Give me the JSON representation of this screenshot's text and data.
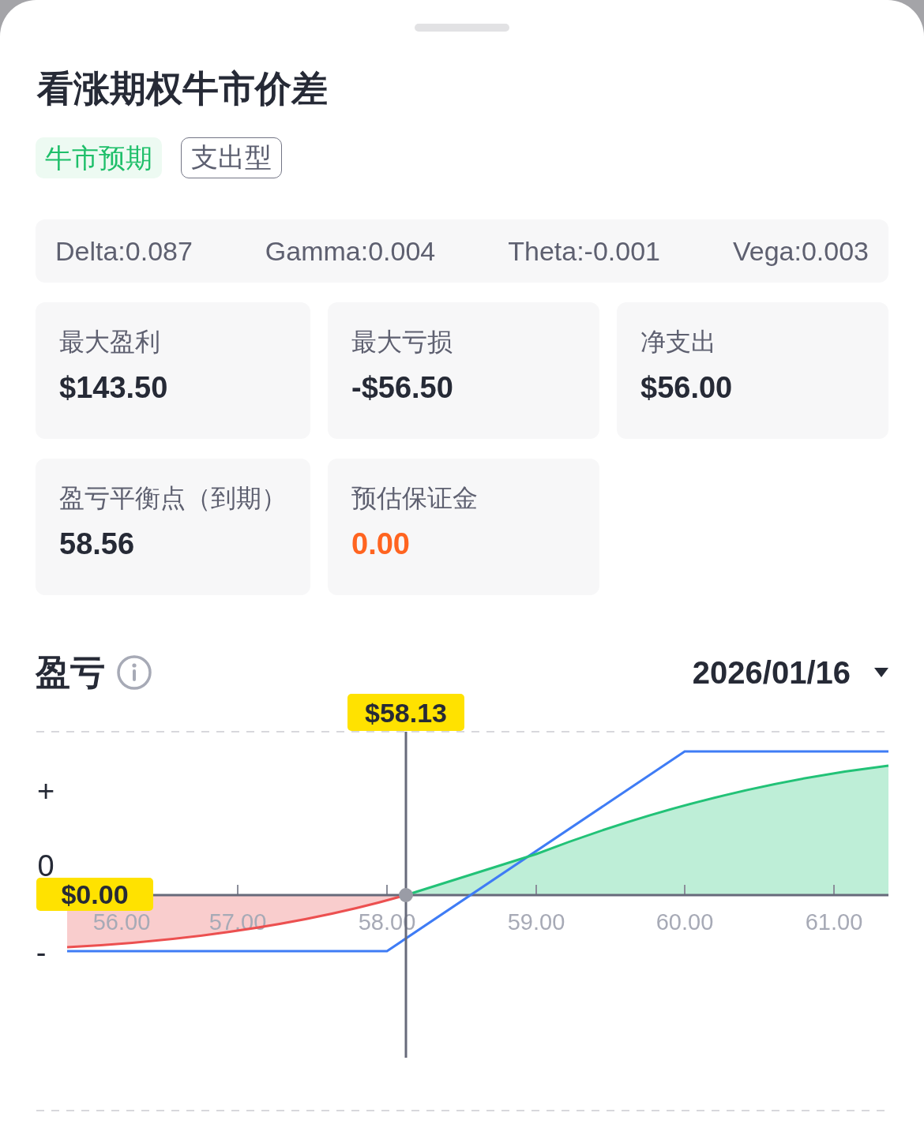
{
  "title": "看涨期权牛市价差",
  "tags": [
    {
      "label": "牛市预期",
      "kind": "filled"
    },
    {
      "label": "支出型",
      "kind": "outline"
    }
  ],
  "greeks": [
    "Delta:0.087",
    "Gamma:0.004",
    "Theta:-0.001",
    "Vega:0.003"
  ],
  "metrics": [
    {
      "label": "最大盈利",
      "value": "$143.50",
      "highlight": false
    },
    {
      "label": "最大亏损",
      "value": "-$56.50",
      "highlight": false
    },
    {
      "label": "净支出",
      "value": "$56.00",
      "highlight": false
    },
    {
      "label": "盈亏平衡点（到期）",
      "value": "58.56",
      "highlight": false
    },
    {
      "label": "预估保证金",
      "value": "0.00",
      "highlight": true
    }
  ],
  "pnl": {
    "title": "盈亏",
    "date": "2026/01/16",
    "y_labels": [
      "+",
      "0",
      "-"
    ],
    "x_labels": [
      "56.00",
      "57.00",
      "58.00",
      "59.00",
      "60.00",
      "61.00"
    ],
    "price_marker": "$58.13",
    "value_marker": "$0.00"
  }
}
